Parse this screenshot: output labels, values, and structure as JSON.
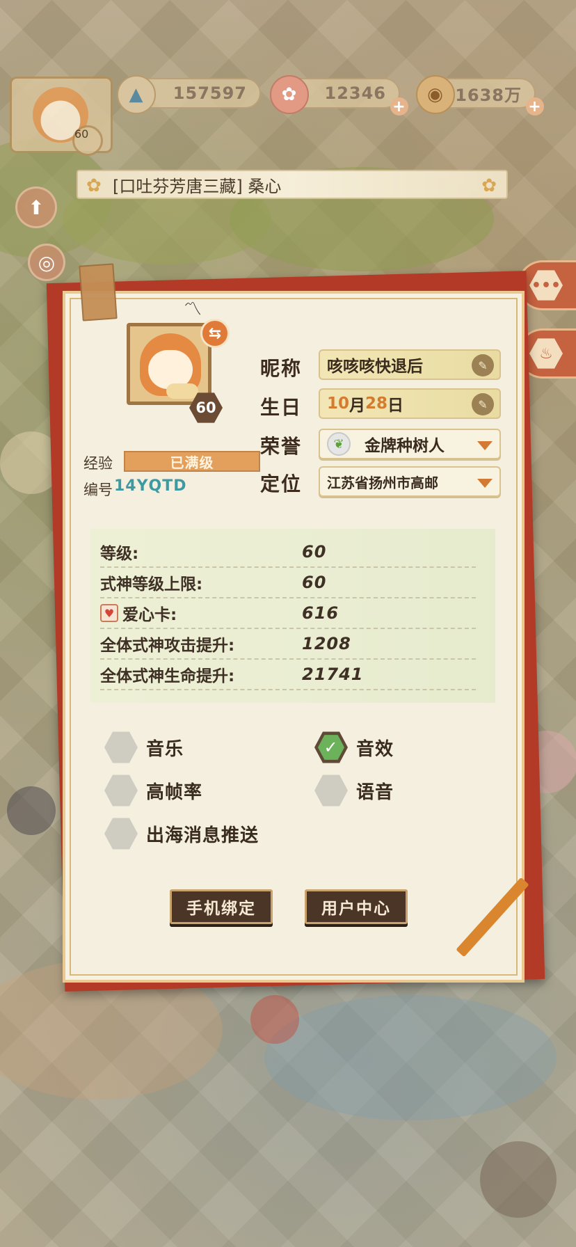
{
  "resources": {
    "jade": "157597",
    "ticket": "12346",
    "coins": "1638万"
  },
  "player": {
    "level_badge": "60",
    "title_line": "[口吐芬芳唐三藏] 桑心"
  },
  "profile": {
    "level": "60",
    "exp_label": "经验",
    "exp_status": "已满级",
    "id_label": "编号",
    "id_value": "14YQTD",
    "nickname_label": "昵称",
    "nickname_value": "咳咳咳快退后",
    "birthday_label": "生日",
    "birthday_month": "10",
    "birthday_month_unit": "月",
    "birthday_day": "28",
    "birthday_day_unit": "日",
    "honor_label": "荣誉",
    "honor_value": "金牌种树人",
    "location_label": "定位",
    "location_value": "江苏省扬州市高邮"
  },
  "stats": [
    {
      "label": "等级:",
      "value": "60"
    },
    {
      "label": "式神等级上限:",
      "value": "60"
    },
    {
      "label": "爱心卡:",
      "value": "616"
    },
    {
      "label": "全体式神攻击提升:",
      "value": "1208"
    },
    {
      "label": "全体式神生命提升:",
      "value": "21741"
    }
  ],
  "settings": [
    {
      "label": "音乐",
      "checked": false
    },
    {
      "label": "音效",
      "checked": true
    },
    {
      "label": "高帧率",
      "checked": false
    },
    {
      "label": "语音",
      "checked": false
    },
    {
      "label": "出海消息推送",
      "checked": false
    }
  ],
  "buttons": {
    "bind_phone": "手机绑定",
    "user_center": "用户中心"
  },
  "icons": {
    "swap": "⇆",
    "edit": "✎",
    "check": "✓",
    "chat": "•••"
  },
  "colors": {
    "card_red": "#b33a26",
    "paper": "#f4efdf",
    "accent_orange": "#d37b2f",
    "id_teal": "#3e9aa2",
    "check_green": "#6bb25a"
  }
}
